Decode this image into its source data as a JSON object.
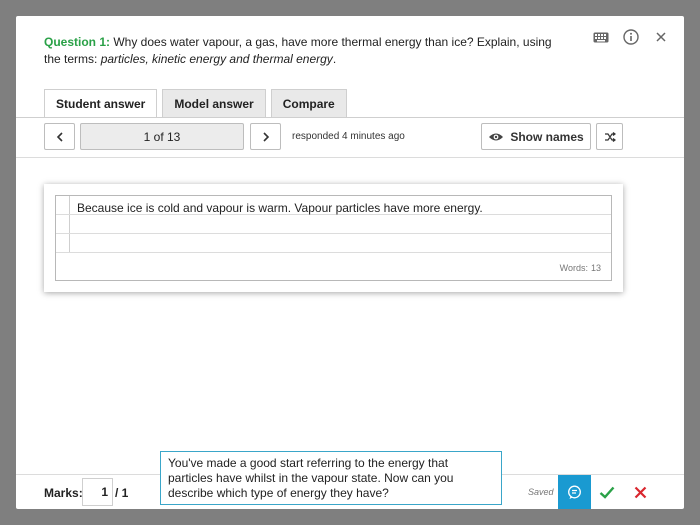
{
  "question": {
    "label": "Question 1:",
    "text": " Why does water vapour, a gas, have more thermal energy than ice? Explain, using the terms: ",
    "terms": "particles, kinetic energy and thermal energy",
    "end": "."
  },
  "icons": {
    "keyboard": "keyboard-icon",
    "info": "info-icon",
    "close": "close-icon"
  },
  "tabs": [
    {
      "label": "Student answer",
      "active": true
    },
    {
      "label": "Model answer",
      "active": false
    },
    {
      "label": "Compare",
      "active": false
    }
  ],
  "nav": {
    "counter": "1 of 13",
    "responded": "responded 4 minutes ago",
    "show_names": "Show names"
  },
  "answer": {
    "text": "Because ice is cold and vapour is warm. Vapour particles have more energy.",
    "words_label": "Words:",
    "words_count": "13"
  },
  "marks": {
    "label": "Marks:",
    "value": "1",
    "total": "/ 1"
  },
  "feedback": {
    "text": "You've made a good start referring to the energy that particles have whilst in the vapour state. Now can you describe which type of energy they have?"
  },
  "status": {
    "saved": "Saved"
  },
  "colors": {
    "accent_green": "#2aa147",
    "comment_blue": "#1a9ad1",
    "cross_red": "#d9262e"
  }
}
